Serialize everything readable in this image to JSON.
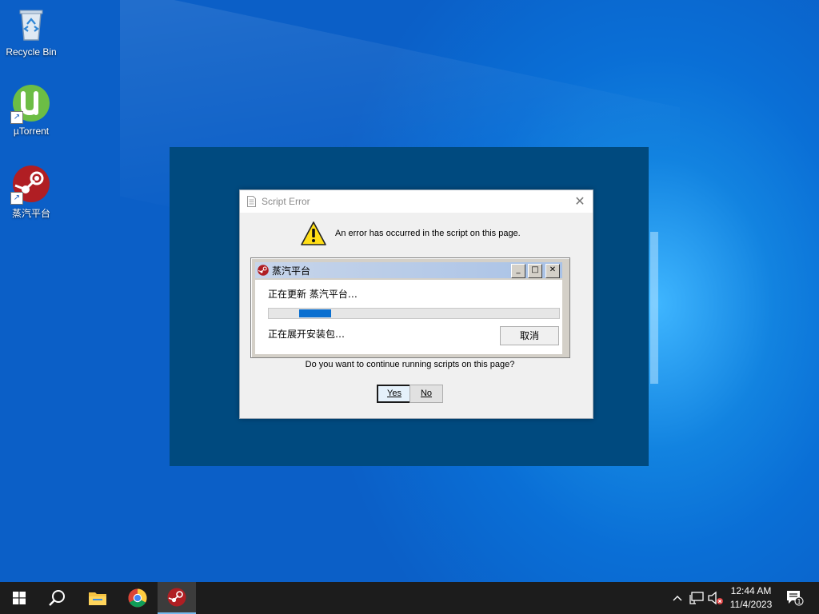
{
  "desktop": {
    "icons": [
      {
        "label": "Recycle Bin",
        "icon": "recycle-bin-icon"
      },
      {
        "label": "µTorrent",
        "icon": "utorrent-icon"
      },
      {
        "label": "蒸汽平台",
        "icon": "steam-icon"
      }
    ]
  },
  "dialog": {
    "title": "Script Error",
    "message": "An error has occurred in the script on this page.",
    "question": "Do you want to continue running scripts on this page?",
    "yes_label": "Yes",
    "no_label": "No"
  },
  "steam_window": {
    "title": "蒸汽平台",
    "status_line": "正在更新 蒸汽平台…",
    "sub_status": "正在展开安装包…",
    "cancel_label": "取消",
    "progress": 0.11,
    "progress_offset": 0.105,
    "minimize_glyph": "_",
    "maximize_glyph": "□",
    "close_glyph": "✕"
  },
  "taskbar": {
    "items": [
      "start-button",
      "search",
      "file-explorer",
      "chrome",
      "steam"
    ],
    "time": "12:44 AM",
    "date": "11/4/2023",
    "notification_count": "1"
  },
  "colors": {
    "desktop_blue": "#0a6fd6",
    "overlay": "#004a7f",
    "taskbar": "#1c1c1c",
    "progress_fill": "#0a6fd0"
  }
}
